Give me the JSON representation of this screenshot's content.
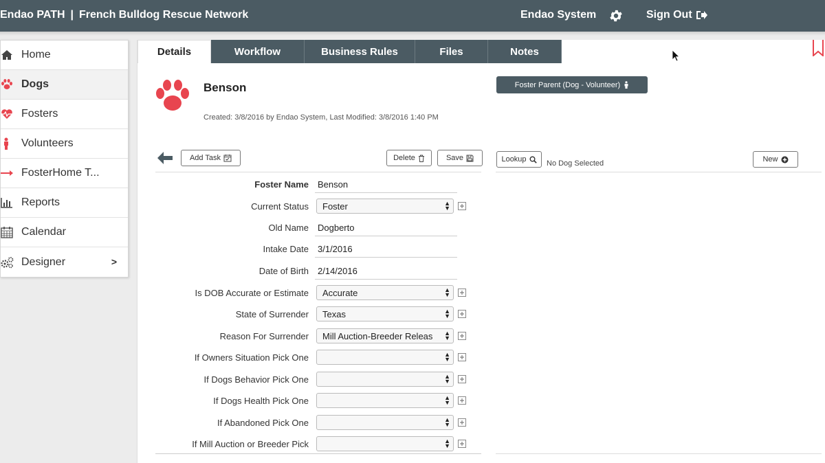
{
  "header": {
    "brand": "Endao PATH",
    "separator": "|",
    "org": "French Bulldog Rescue Network",
    "system_name": "Endao System",
    "signout_label": "Sign Out",
    "bg_color": "#4b5b63"
  },
  "sidebar": {
    "items": [
      {
        "label": "Home",
        "icon": "home-icon"
      },
      {
        "label": "Dogs",
        "icon": "paw-icon",
        "active": true
      },
      {
        "label": "Fosters",
        "icon": "heartbeat-icon"
      },
      {
        "label": "Volunteers",
        "icon": "person-icon"
      },
      {
        "label": "FosterHome T...",
        "icon": "arrow-right-icon"
      },
      {
        "label": "Reports",
        "icon": "bar-chart-icon"
      },
      {
        "label": "Calendar",
        "icon": "calendar-icon"
      },
      {
        "label": "Designer",
        "icon": "cogs-icon",
        "chevron": ">"
      }
    ]
  },
  "tabs": [
    {
      "label": "Details",
      "active": true
    },
    {
      "label": "Workflow"
    },
    {
      "label": "Business Rules"
    },
    {
      "label": "Files"
    },
    {
      "label": "Notes"
    }
  ],
  "record": {
    "name": "Benson",
    "meta": "Created: 3/8/2016 by Endao System, Last Modified: 3/8/2016 1:40 PM",
    "foster_button": "Foster Parent (Dog - Volunteer)",
    "accent": "#e8454f"
  },
  "toolbar": {
    "add_task": "Add Task",
    "delete": "Delete",
    "save": "Save",
    "lookup": "Lookup",
    "no_dog": "No Dog Selected",
    "new": "New"
  },
  "form": {
    "foster_name": {
      "label": "Foster Name",
      "value": "Benson"
    },
    "current_status": {
      "label": "Current Status",
      "value": "Foster"
    },
    "old_name": {
      "label": "Old Name",
      "value": "Dogberto"
    },
    "intake_date": {
      "label": "Intake Date",
      "value": "3/1/2016"
    },
    "dob": {
      "label": "Date of Birth",
      "value": "2/14/2016"
    },
    "dob_accuracy": {
      "label": "Is DOB Accurate or Estimate",
      "value": "Accurate"
    },
    "state": {
      "label": "State of Surrender",
      "value": "Texas"
    },
    "reason": {
      "label": "Reason For Surrender",
      "value": "Mill Auction-Breeder Releas"
    },
    "owners": {
      "label": "If Owners Situation Pick One",
      "value": ""
    },
    "behavior": {
      "label": "If Dogs Behavior Pick One",
      "value": ""
    },
    "health": {
      "label": "If Dogs Health Pick One",
      "value": ""
    },
    "abandoned": {
      "label": "If Abandoned Pick One",
      "value": ""
    },
    "mill": {
      "label": "If Mill Auction or Breeder Pick",
      "value": ""
    }
  }
}
